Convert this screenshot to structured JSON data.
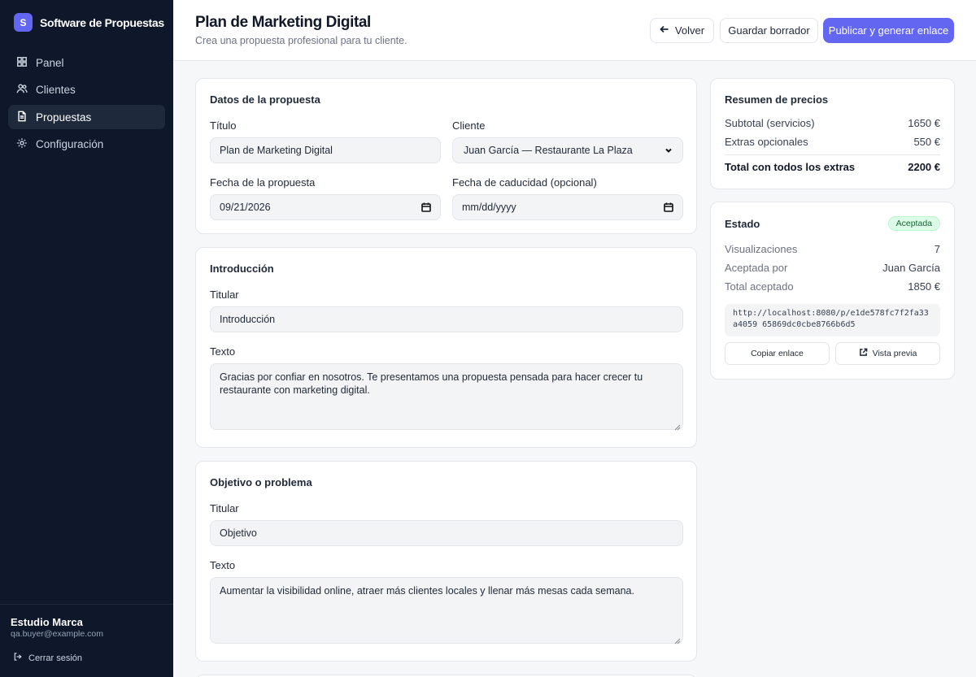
{
  "app": {
    "brand_letter": "S",
    "brand_name": "Software de Propuestas"
  },
  "sidebar": {
    "items": [
      {
        "label": "Panel",
        "icon": "grid-icon"
      },
      {
        "label": "Clientes",
        "icon": "users-icon"
      },
      {
        "label": "Propuestas",
        "icon": "document-icon",
        "active": true
      },
      {
        "label": "Configuración",
        "icon": "gear-icon"
      }
    ],
    "footer": {
      "org": "Estudio Marca",
      "email": "qa.buyer@example.com",
      "logout": "Cerrar sesión"
    }
  },
  "header": {
    "title": "Plan de Marketing Digital",
    "subtitle": "Crea una propuesta profesional para tu cliente.",
    "back_label": "Volver",
    "draft_label": "Guardar borrador",
    "publish_label": "Publicar y generar enlace"
  },
  "details": {
    "section_title": "Datos de la propuesta",
    "title_label": "Título",
    "title_value": "Plan de Marketing Digital",
    "client_label": "Cliente",
    "client_value": "Juan García — Restaurante La Plaza",
    "date_label": "Fecha de la propuesta",
    "date_value": "09/21/2026",
    "expiry_label": "Fecha de caducidad (opcional)",
    "expiry_placeholder": "mm/dd/yyyy"
  },
  "intro": {
    "section_title": "Introducción",
    "heading_label": "Titular",
    "heading_value": "Introducción",
    "text_label": "Texto",
    "text_value": "Gracias por confiar en nosotros. Te presentamos una propuesta pensada para hacer crecer tu restaurante con marketing digital."
  },
  "objective": {
    "section_title": "Objetivo o problema",
    "heading_label": "Titular",
    "heading_value": "Objetivo",
    "text_label": "Texto",
    "text_value": "Aumentar la visibilidad online, atraer más clientes locales y llenar más mesas cada semana."
  },
  "pricing": {
    "title": "Resumen de precios",
    "subtotal_label": "Subtotal (servicios)",
    "subtotal_value": "1650 €",
    "extras_label": "Extras opcionales",
    "extras_value": "550 €",
    "total_label": "Total con todos los extras",
    "total_value": "2200 €"
  },
  "status": {
    "title": "Estado",
    "badge": "Aceptada",
    "views_label": "Visualizaciones",
    "views_value": "7",
    "accepted_by_label": "Aceptada por",
    "accepted_by_value": "Juan García",
    "accepted_total_label": "Total aceptado",
    "accepted_total_value": "1850 €",
    "link": "http://localhost:8080/p/e1de578fc7f2fa33a4059 65869dc0cbe8766b6d5",
    "copy_label": "Copiar enlace",
    "preview_label": "Vista previa"
  },
  "colors": {
    "accent": "#6366f1",
    "sidebar_bg": "#0f172a",
    "badge_bg": "#dcfce7"
  }
}
